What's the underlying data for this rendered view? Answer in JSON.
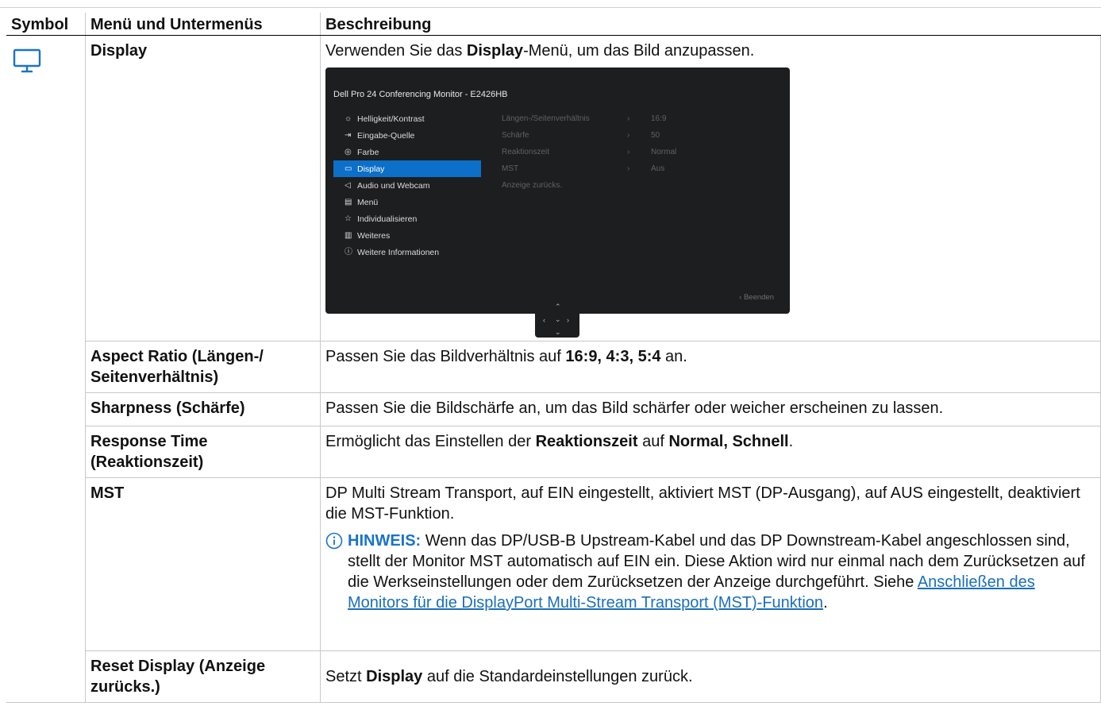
{
  "table": {
    "headers": {
      "symbol": "Symbol",
      "menu": "Menü und Untermenüs",
      "description": "Beschreibung"
    }
  },
  "display_row": {
    "icon": "monitor-icon",
    "menu": "Display",
    "desc_prefix": "Verwenden Sie das ",
    "desc_bold": "Display",
    "desc_suffix": "-Menü, um das Bild anzupassen."
  },
  "osd": {
    "title": "Dell Pro 24 Conferencing Monitor - E2426HB",
    "menu_items": [
      {
        "icon": "sun-icon",
        "label": "Helligkeit/Kontrast"
      },
      {
        "icon": "input-icon",
        "label": "Eingabe-Quelle"
      },
      {
        "icon": "palette-icon",
        "label": "Farbe"
      },
      {
        "icon": "monitor-icon",
        "label": "Display"
      },
      {
        "icon": "speaker-icon",
        "label": "Audio und Webcam"
      },
      {
        "icon": "menu-icon",
        "label": "Menü"
      },
      {
        "icon": "star-icon",
        "label": "Individualisieren"
      },
      {
        "icon": "others-icon",
        "label": "Weiteres"
      },
      {
        "icon": "info-icon",
        "label": "Weitere Informationen"
      }
    ],
    "active_item": "Display",
    "submenu": [
      {
        "label": "Längen-/Seitenverhältnis",
        "arrow": "›",
        "value": "16:9"
      },
      {
        "label": "Schärfe",
        "arrow": "›",
        "value": "50"
      },
      {
        "label": "Reaktionszeit",
        "arrow": "›",
        "value": "Normal"
      },
      {
        "label": "MST",
        "arrow": "›",
        "value": "Aus"
      },
      {
        "label": "Anzeige zurücks.",
        "arrow": "",
        "value": ""
      }
    ],
    "exit": "‹  Beenden"
  },
  "rows": {
    "aspect": {
      "menu": "Aspect Ratio (Längen-/ Seitenverhältnis)",
      "desc_prefix": "Passen Sie das Bildverhältnis auf ",
      "desc_bold": "16:9, 4:3, 5:4",
      "desc_suffix": " an."
    },
    "sharpness": {
      "menu": "Sharpness (Schärfe)",
      "desc": "Passen Sie die Bildschärfe an, um das Bild schärfer oder weicher erscheinen zu lassen."
    },
    "response": {
      "menu": "Response Time (Reaktionszeit)",
      "desc_prefix": "Ermöglicht das Einstellen der ",
      "desc_bold1": "Reaktionszeit",
      "desc_mid": " auf ",
      "desc_bold2": "Normal, Schnell",
      "desc_suffix": "."
    },
    "mst": {
      "menu": "MST",
      "desc": "DP Multi Stream Transport, auf EIN eingestellt, aktiviert MST (DP-Ausgang), auf AUS eingestellt, deaktiviert die MST-Funktion.",
      "note_label": "HINWEIS:",
      "note_text": " Wenn das DP/USB-B Upstream-Kabel und das DP Downstream-Kabel angeschlossen sind, stellt der Monitor MST automatisch auf EIN ein. Diese Aktion wird nur einmal nach dem Zurücksetzen auf die Werkseinstellungen oder dem Zurücksetzen der Anzeige durchgeführt. Siehe ",
      "note_link": "Anschließen des Monitors für die DisplayPort Multi-Stream Transport (MST)-Funktion",
      "note_end": "."
    },
    "reset": {
      "menu": "Reset Display (Anzeige zurücks.)",
      "desc_prefix": "Setzt ",
      "desc_bold": "Display",
      "desc_suffix": " auf die Standardeinstellungen zurück."
    }
  },
  "colors": {
    "accent": "#0c6fc8",
    "osd_bg": "#1d1e20",
    "link": "#1a6fb8"
  }
}
